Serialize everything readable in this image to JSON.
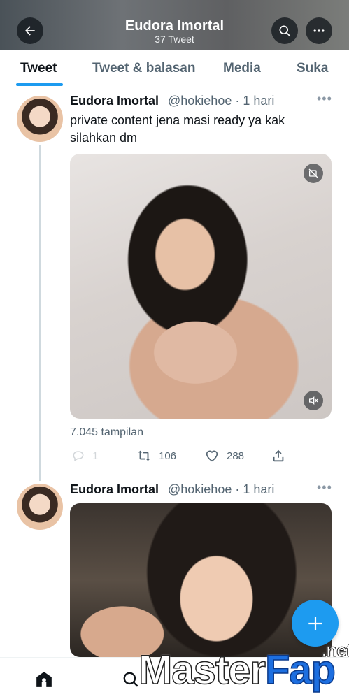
{
  "header": {
    "title": "Eudora Imortal",
    "subtitle": "37 Tweet"
  },
  "tabs": [
    {
      "label": "Tweet",
      "active": true
    },
    {
      "label": "Tweet & balasan",
      "active": false
    },
    {
      "label": "Media",
      "active": false
    },
    {
      "label": "Suka",
      "active": false
    }
  ],
  "tweets": [
    {
      "name": "Eudora Imortal",
      "handle": "@hokiehoe",
      "time": "· 1 hari",
      "text": "private content jena masi ready ya kak silahkan dm",
      "views": "7.045 tampilan",
      "replies": "1",
      "retweets": "106",
      "likes": "288"
    },
    {
      "name": "Eudora Imortal",
      "handle": "@hokiehoe",
      "time": "· 1 hari"
    }
  ],
  "watermark": {
    "part1": "Master",
    "part2": "Fap",
    "suffix": ".net"
  },
  "colors": {
    "accent": "#1d9bf0",
    "text": "#0f1419",
    "muted": "#536471"
  },
  "icons": [
    "back-arrow-icon",
    "search-icon",
    "more-icon",
    "crop-off-icon",
    "mute-icon",
    "reply-icon",
    "retweet-icon",
    "heart-icon",
    "share-icon",
    "home-icon",
    "compose-plus-icon"
  ]
}
